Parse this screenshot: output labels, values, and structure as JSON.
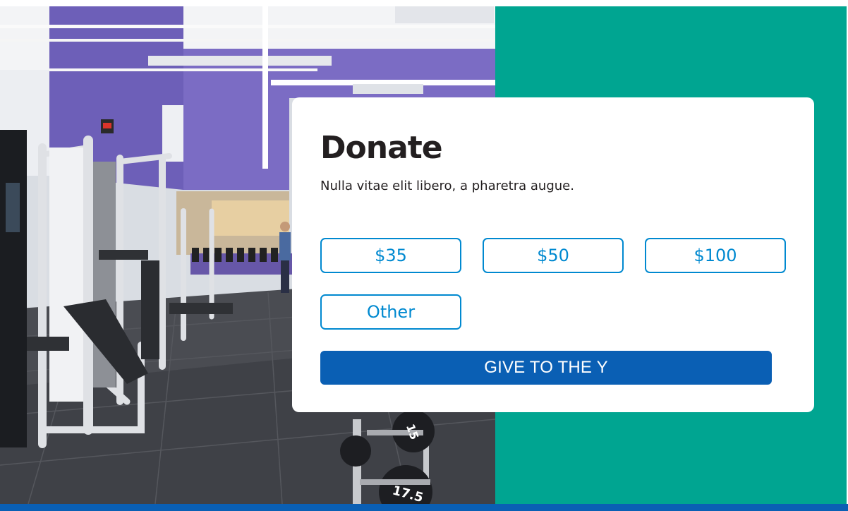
{
  "donate": {
    "title": "Donate",
    "subtitle": "Nulla vitae elit libero, a pharetra augue.",
    "amounts": [
      "$35",
      "$50",
      "$100",
      "Other"
    ],
    "cta_label": "GIVE TO THE Y"
  },
  "photo": {
    "dumbbell_labels": [
      "15",
      "17.5"
    ]
  },
  "colors": {
    "teal_panel": "#00a591",
    "primary_blue": "#0a5fb4",
    "amount_blue": "#0089d0",
    "text_dark": "#231f20",
    "card_bg": "#ffffff"
  }
}
